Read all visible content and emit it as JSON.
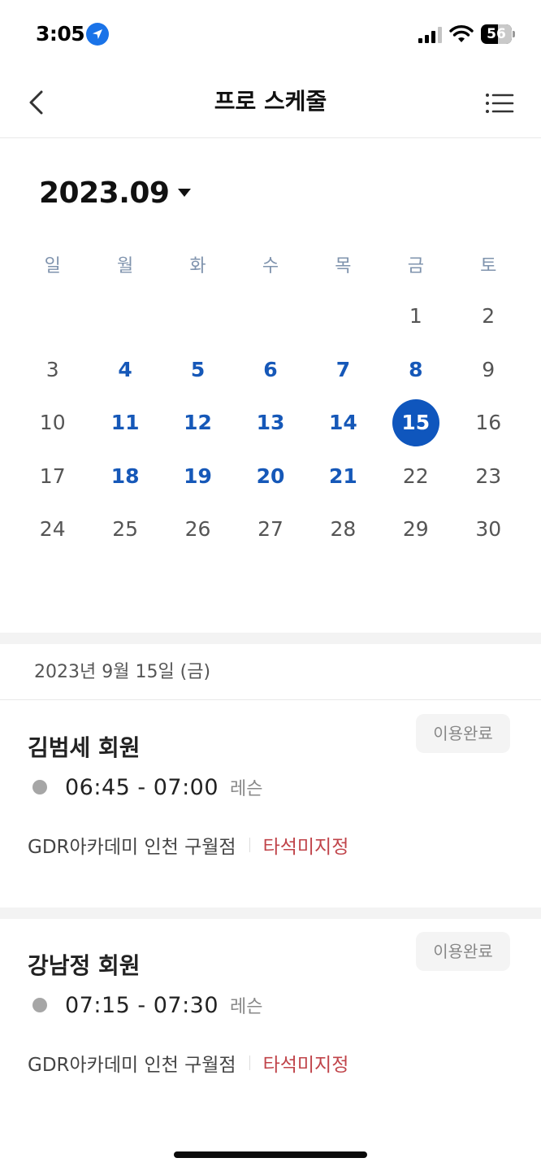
{
  "status_bar": {
    "time": "3:05",
    "battery": "56",
    "battery_level": 0.56
  },
  "header": {
    "title": "프로 스케줄",
    "back_icon": "chevron-left-icon",
    "menu_icon": "list-menu-icon"
  },
  "calendar": {
    "month_label": "2023.09",
    "weekdays": [
      "일",
      "월",
      "화",
      "수",
      "목",
      "금",
      "토"
    ],
    "weeks": [
      [
        null,
        null,
        null,
        null,
        null,
        1,
        2
      ],
      [
        3,
        4,
        5,
        6,
        7,
        8,
        9
      ],
      [
        10,
        11,
        12,
        13,
        14,
        15,
        16
      ],
      [
        17,
        18,
        19,
        20,
        21,
        22,
        23
      ],
      [
        24,
        25,
        26,
        27,
        28,
        29,
        30
      ]
    ],
    "scheduled_days": [
      4,
      5,
      6,
      7,
      8,
      11,
      12,
      13,
      14,
      18,
      19,
      20,
      21
    ],
    "selected_day": 15
  },
  "schedule": {
    "date_heading": "2023년 9월 15일 (금)",
    "items": [
      {
        "member": "김범세 회원",
        "status": "이용완료",
        "time": "06:45  -  07:00",
        "type": "레슨",
        "location": "GDR아카데미 인천 구월점",
        "bay": "타석미지정"
      },
      {
        "member": "강남정 회원",
        "status": "이용완료",
        "time": "07:15  -  07:30",
        "type": "레슨",
        "location": "GDR아카데미 인천 구월점",
        "bay": "타석미지정"
      }
    ]
  },
  "colors": {
    "accent": "#0f56bd",
    "scheduled": "#1658b8",
    "bay_warning": "#c0444a",
    "weekday": "#7f93ad"
  }
}
